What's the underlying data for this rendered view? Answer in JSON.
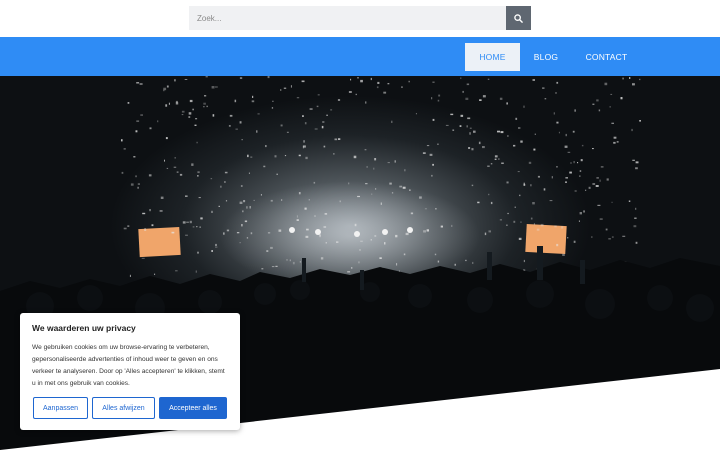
{
  "search": {
    "placeholder": "Zoek...",
    "icon": "search-icon"
  },
  "nav": {
    "items": [
      {
        "label": "HOME",
        "active": true
      },
      {
        "label": "BLOG",
        "active": false
      },
      {
        "label": "CONTACT",
        "active": false
      }
    ]
  },
  "colors": {
    "nav": "#2f8cf5",
    "button": "#1e66d0",
    "search_button": "#5f6771"
  },
  "cookie": {
    "title": "We waarderen uw privacy",
    "text": "We gebruiken cookies om uw browse-ervaring te verbeteren, gepersonaliseerde advertenties of inhoud weer te geven en ons verkeer te analyseren. Door op 'Alles accepteren' te klikken, stemt u in met ons gebruik van cookies.",
    "customize_label": "Aanpassen",
    "reject_label": "Alles afwijzen",
    "accept_label": "Accepteer alles"
  }
}
